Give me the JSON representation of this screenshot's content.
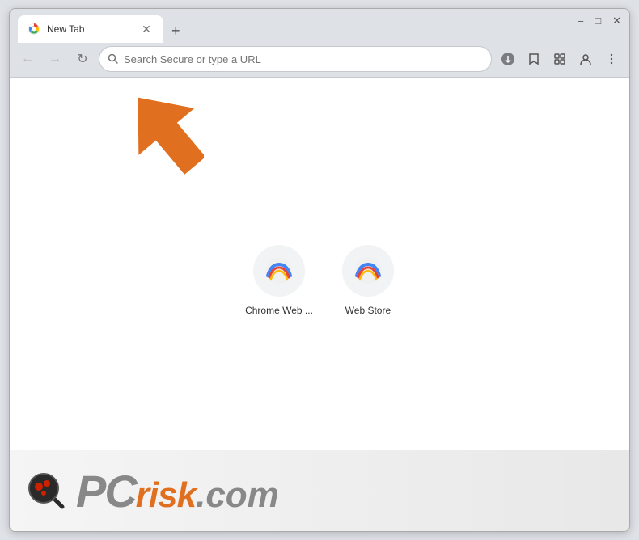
{
  "window": {
    "title": "New Tab",
    "controls": {
      "minimize": "–",
      "maximize": "□",
      "close": "✕"
    }
  },
  "tab": {
    "title": "New Tab",
    "close_label": "✕"
  },
  "new_tab_button": "+",
  "toolbar": {
    "back_label": "←",
    "forward_label": "→",
    "reload_label": "↻",
    "address_placeholder": "Search Secure or type a URL",
    "bookmark_label": "☆",
    "extensions_label": "🧩",
    "profile_label": "👤",
    "menu_label": "⋮",
    "download_icon": "⬇"
  },
  "shortcuts": [
    {
      "label": "Chrome Web ...",
      "icon_type": "chrome-rainbow"
    },
    {
      "label": "Web Store",
      "icon_type": "chrome-rainbow"
    }
  ],
  "watermark": {
    "site": "PCrisk.com",
    "pc": "PC",
    "risk": "risk",
    "dot_com": ".com"
  },
  "colors": {
    "orange": "#e87c2b",
    "tab_bg": "#ffffff",
    "toolbar_bg": "#dee1e6",
    "accent_blue": "#1a73e8"
  }
}
